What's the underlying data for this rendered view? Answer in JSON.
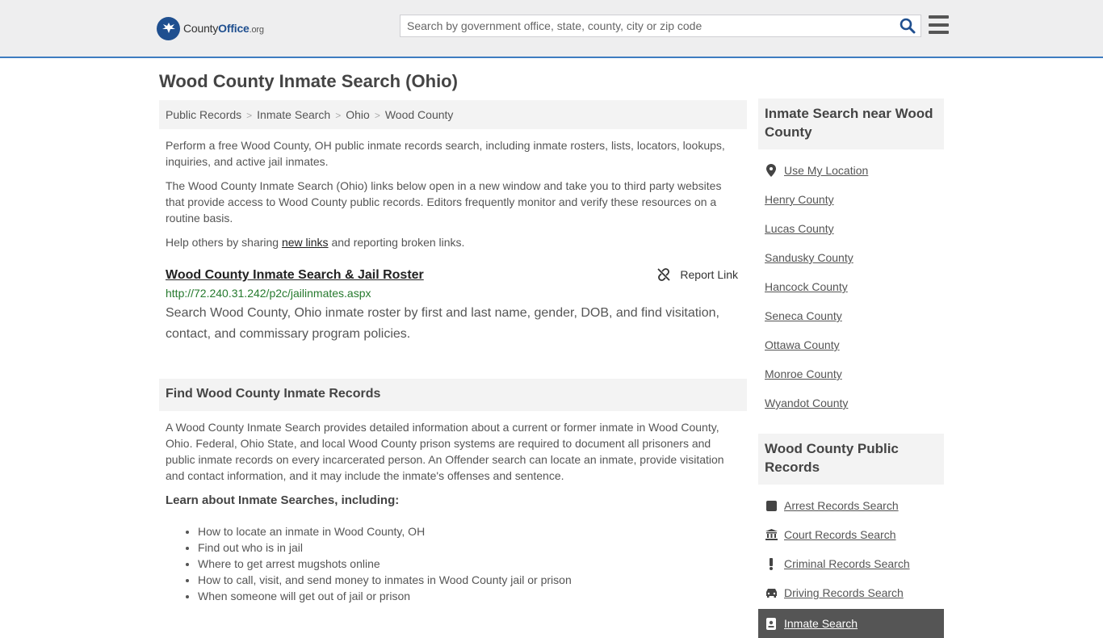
{
  "header": {
    "logo_county": "County",
    "logo_office": "Office",
    "logo_tld": ".org",
    "search_placeholder": "Search by government office, state, county, city or zip code"
  },
  "page": {
    "title": "Wood County Inmate Search (Ohio)"
  },
  "breadcrumb": [
    "Public Records",
    "Inmate Search",
    "Ohio",
    "Wood County"
  ],
  "intro": {
    "p1": "Perform a free Wood County, OH public inmate records search, including inmate rosters, lists, locators, lookups, inquiries, and active jail inmates.",
    "p2": "The Wood County Inmate Search (Ohio) links below open in a new window and take you to third party websites that provide access to Wood County public records. Editors frequently monitor and verify these resources on a routine basis.",
    "p3_before": "Help others by sharing ",
    "p3_link": "new links",
    "p3_after": " and reporting broken links."
  },
  "result": {
    "title": "Wood County Inmate Search & Jail Roster",
    "report_label": "Report Link",
    "url": "http://72.240.31.242/p2c/jailinmates.aspx",
    "description": "Search Wood County, Ohio inmate roster by first and last name, gender, DOB, and find visitation, contact, and commissary program policies."
  },
  "find_section": {
    "heading": "Find Wood County Inmate Records",
    "body": "A Wood County Inmate Search provides detailed information about a current or former inmate in Wood County, Ohio. Federal, Ohio State, and local Wood County prison systems are required to document all prisoners and public inmate records on every incarcerated person. An Offender search can locate an inmate, provide visitation and contact information, and it may include the inmate's offenses and sentence.",
    "learn_heading": "Learn about Inmate Searches, including:",
    "learn_items": [
      "How to locate an inmate in Wood County, OH",
      "Find out who is in jail",
      "Where to get arrest mugshots online",
      "How to call, visit, and send money to inmates in Wood County jail or prison",
      "When someone will get out of jail or prison"
    ]
  },
  "sidebar": {
    "nearby_heading": "Inmate Search near Wood County",
    "use_location": "Use My Location",
    "nearby": [
      "Henry County",
      "Lucas County",
      "Sandusky County",
      "Hancock County",
      "Seneca County",
      "Ottawa County",
      "Monroe County",
      "Wyandot County"
    ],
    "records_heading": "Wood County Public Records",
    "records": [
      {
        "label": "Arrest Records Search",
        "icon": "square-icon"
      },
      {
        "label": "Court Records Search",
        "icon": "courthouse-icon"
      },
      {
        "label": "Criminal Records Search",
        "icon": "exclamation-icon"
      },
      {
        "label": "Driving Records Search",
        "icon": "car-icon"
      }
    ],
    "active_item": {
      "label": "Inmate Search",
      "icon": "id-badge-icon"
    }
  },
  "colors": {
    "accent_blue": "#3d7cc0",
    "logo_blue": "#1f4f8f",
    "url_green": "#267a2e",
    "panel_gray": "#f3f3f3",
    "active_dark": "#555555"
  }
}
